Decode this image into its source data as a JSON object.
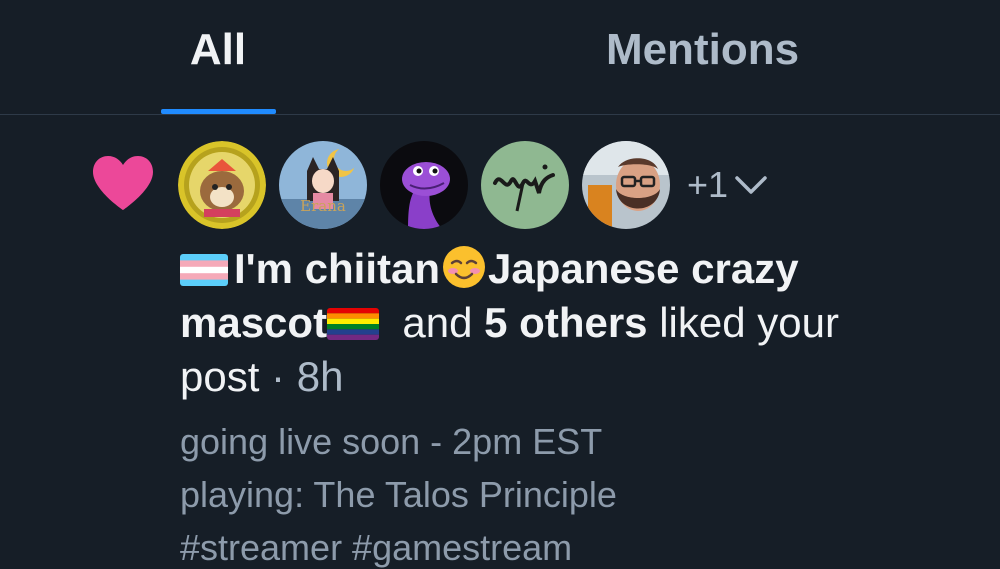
{
  "tabs": {
    "all": "All",
    "mentions": "Mentions"
  },
  "notification": {
    "icon": "heart-icon",
    "heart_color": "#ec4899",
    "avatars": [
      "avatar-chiitan",
      "avatar-erana",
      "avatar-dinosaur",
      "avatar-yuvi",
      "avatar-bearded-man"
    ],
    "extra_count": "+1",
    "actor_name": "I'm chiitan",
    "actor_name_2": "Japanese crazy",
    "actor_name_3": "mascot",
    "and_text": "and",
    "others_text": "5 others",
    "action_text": "liked your",
    "post_text": "post",
    "time_sep": " · ",
    "time": "8h",
    "post_preview": [
      "going live soon - 2pm EST",
      "playing: The Talos Principle",
      "#streamer #gamestream"
    ]
  },
  "colors": {
    "background": "#161e27",
    "accent": "#208bfe",
    "text": "#f1f3f5",
    "muted": "#aebbc9"
  }
}
